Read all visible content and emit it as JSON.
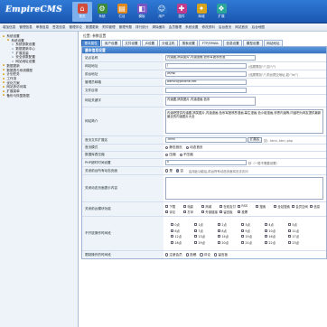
{
  "header": {
    "logo": "EmpireCMS",
    "nav": [
      {
        "label": "首页",
        "icon": "home-icon",
        "glyph": "⌂",
        "color": "#d24a3a",
        "active": true
      },
      {
        "label": "系统",
        "icon": "system-icon",
        "glyph": "⚙",
        "color": "#3c8a3c"
      },
      {
        "label": "栏目",
        "icon": "column-icon",
        "glyph": "▤",
        "color": "#e08a1e"
      },
      {
        "label": "模板",
        "icon": "template-icon",
        "glyph": "◧",
        "color": "#7a55c4"
      },
      {
        "label": "用户",
        "icon": "user-icon",
        "glyph": "☺",
        "color": "#2b72c9"
      },
      {
        "label": "插件",
        "icon": "plugin-icon",
        "glyph": "✚",
        "color": "#c23b8a"
      },
      {
        "label": "商城",
        "icon": "shop-icon",
        "glyph": "✦",
        "color": "#d9a21b"
      },
      {
        "label": "扩展",
        "icon": "extend-icon",
        "glyph": "❖",
        "color": "#2aa59a"
      }
    ]
  },
  "submenu": [
    "增加信息",
    "管理信息",
    "审核信息",
    "签发信息",
    "管理评论",
    "数据更新",
    "附件管理",
    "管理专题",
    "排行统计",
    "清除缓存",
    "会员管理",
    "系统设置",
    "修改资料",
    "后台首页",
    "网站首页",
    "后台地图"
  ],
  "sidebar": {
    "items": [
      {
        "label": "系统设置",
        "icon": "folder-icon",
        "indent": 0,
        "kind": "folder",
        "glyph": "▪"
      },
      {
        "label": "系统设置",
        "icon": "folder-icon",
        "indent": 1,
        "kind": "folder",
        "glyph": "▪"
      },
      {
        "label": "系统参数设置",
        "icon": "page-icon",
        "indent": 2,
        "kind": "page",
        "glyph": "▫"
      },
      {
        "label": "数据更新中心",
        "icon": "page-icon",
        "indent": 2,
        "kind": "page",
        "glyph": "▫"
      },
      {
        "label": "扩展变量",
        "icon": "page-icon",
        "indent": 2,
        "kind": "page",
        "glyph": "▫"
      },
      {
        "label": "安全参数配置",
        "icon": "page-icon",
        "indent": 2,
        "kind": "page",
        "glyph": "▫"
      },
      {
        "label": "网站地址设置",
        "icon": "page-icon",
        "indent": 2,
        "kind": "page",
        "glyph": "▫"
      },
      {
        "label": "数据更新",
        "icon": "folder-icon",
        "indent": 0,
        "kind": "folder",
        "glyph": "▪"
      },
      {
        "label": "数据表与系统模型",
        "icon": "folder-icon",
        "indent": 0,
        "kind": "folder",
        "glyph": "▪"
      },
      {
        "label": "计划任务",
        "icon": "folder-icon",
        "indent": 0,
        "kind": "folder",
        "glyph": "▪"
      },
      {
        "label": "工作流",
        "icon": "folder-icon",
        "indent": 0,
        "kind": "folder",
        "glyph": "▪"
      },
      {
        "label": "优化方案",
        "icon": "folder-icon",
        "indent": 0,
        "kind": "folder",
        "glyph": "▪"
      },
      {
        "label": "网站多访问端",
        "icon": "folder-icon",
        "indent": 0,
        "kind": "folder",
        "glyph": "▪"
      },
      {
        "label": "扩展菜单",
        "icon": "folder-icon",
        "indent": 0,
        "kind": "folder",
        "glyph": "▪"
      },
      {
        "label": "备份与恢复数据",
        "icon": "folder-icon",
        "indent": 0,
        "kind": "folder",
        "glyph": "▪"
      }
    ]
  },
  "breadcrumb": "位置: 参数设置",
  "tabs": [
    {
      "label": "基本属性",
      "active": true
    },
    {
      "label": "用户设置"
    },
    {
      "label": "文件设置"
    },
    {
      "label": "JS设置"
    },
    {
      "label": "分组主机"
    },
    {
      "label": "搜索设置"
    },
    {
      "label": "FTP/EMAIL"
    },
    {
      "label": "信息设置"
    },
    {
      "label": "模型设置"
    },
    {
      "label": "网站地址"
    }
  ],
  "form": {
    "section_title": "基本信息设置",
    "site_name_label": "站点名称",
    "site_name_value": "内涵图,搞笑图片,内涵漫画,色系军团邪恶漫",
    "site_url_label": "网站地址",
    "site_url_value": "/",
    "site_url_hint": "(结尾需加\"/\",如:\"/\")",
    "front_url_label": "前台地址",
    "front_url_value": "/e/fw/",
    "front_url_hint": "(结尾需加\"/\",前台提交地址,如:\"/e/\")",
    "email_label": "管理员邮箱",
    "email_value": "admin@phome.net",
    "file_mgmt_label": "文件目录",
    "file_mgmt_value": "",
    "keywords_label": "网站关键字",
    "keywords_value": "内涵图,搞笑图片,内涵漫画,色系",
    "description_label": "网站简介",
    "description_value": "内涵吧提供内涵图,搞笑图片,内涵漫画,色系军团邪恶漫画,幕生漫画,色小组漫画,邪恶内涵等,内涵吧为网友提供最新最全的内涵图片大全",
    "index_ext_label": "首页文件扩展名",
    "index_ext_value": ".html",
    "index_ext_button": "扩展名",
    "index_ext_hint": "如: .html,.htm,.php",
    "index_mode_label": "首页模式",
    "index_mode_options": [
      "静态首页",
      "动态首页"
    ],
    "compress_label": "数据库表压缩",
    "compress_options": [
      "压缩",
      "不压缩"
    ],
    "php_time_label": "PHP超时时间设置",
    "php_time_value": "0",
    "php_time_hint": "秒（一般不需要设置）",
    "close_front_label": "关闭前台所有动态页面",
    "close_front_options": [
      "是",
      "否"
    ],
    "close_front_hint": "启用此功能后,前台所有动态页面将无法访问",
    "close_reason_label": "关闭动态页面提示内容",
    "close_reason_value": "",
    "close_modules_label": "关闭前台模块功能",
    "close_modules": [
      "下载",
      "电影",
      "商城",
      "在线支付",
      "RSS",
      "搜索",
      "全站搜索",
      "会员空间",
      "信息",
      "评论",
      "打印",
      "外部链接",
      "留言板",
      "投票"
    ],
    "hours_label": "不开放操作时间段",
    "hours": [
      "0点",
      "1点",
      "2点",
      "3点",
      "4点",
      "5点",
      "6点",
      "7点",
      "8点",
      "9点",
      "10点",
      "11点",
      "12点",
      "13点",
      "14点",
      "15点",
      "16点",
      "17点",
      "18点",
      "19点",
      "20点",
      "21点",
      "22点",
      "23点"
    ],
    "restrict_label": "限制操作的时间段",
    "restrict_options": [
      "注册会员",
      "投稿",
      "评论",
      "留言板"
    ]
  },
  "colors": {
    "header_top": "#2f7ad6",
    "header_bottom": "#1a56b0",
    "active_tab": "#4a86d0",
    "sidebar_bg": "#eef3f9"
  }
}
